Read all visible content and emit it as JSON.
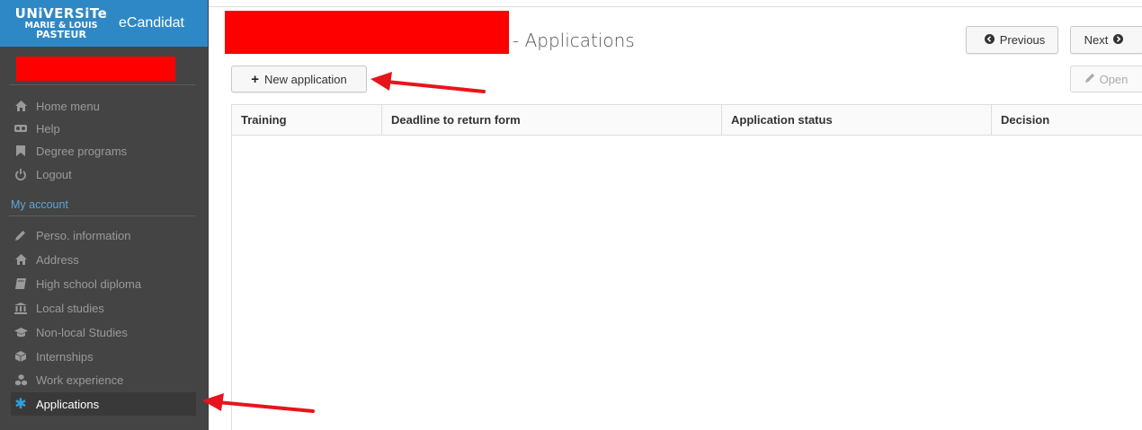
{
  "brand": {
    "logo_line1": "UNiVERSiTe",
    "logo_line2": "MARIE & LOUIS",
    "logo_line3": "PASTEUR",
    "app_name": "eCandidat",
    "color": "#2f88c6"
  },
  "sidebar": {
    "menu_items": [
      {
        "label": "Home menu",
        "icon": "home-icon"
      },
      {
        "label": "Help",
        "icon": "help-icon"
      },
      {
        "label": "Degree programs",
        "icon": "bookmark-icon"
      },
      {
        "label": "Logout",
        "icon": "power-icon"
      }
    ],
    "account_section_label": "My account",
    "account_items": [
      {
        "label": "Perso. information",
        "icon": "pencil-icon"
      },
      {
        "label": "Address",
        "icon": "home-icon"
      },
      {
        "label": "High school diploma",
        "icon": "book-icon"
      },
      {
        "label": "Local studies",
        "icon": "institution-icon"
      },
      {
        "label": "Non-local Studies",
        "icon": "graduation-cap-icon"
      },
      {
        "label": "Internships",
        "icon": "cube-icon"
      },
      {
        "label": "Work experience",
        "icon": "cubes-icon"
      },
      {
        "label": "Applications",
        "icon": "asterisk-icon",
        "active": true
      }
    ],
    "background": "#444444",
    "active_icon_color": "#2f9fe0"
  },
  "header": {
    "title_suffix": "- Applications",
    "previous_label": "Previous",
    "next_label": "Next"
  },
  "toolbar": {
    "new_application_label": "New application",
    "open_label": "Open"
  },
  "table": {
    "columns": [
      "Training",
      "Deadline to return form",
      "Application status",
      "Decision"
    ],
    "rows": []
  },
  "annotation_color": "#e8141b"
}
